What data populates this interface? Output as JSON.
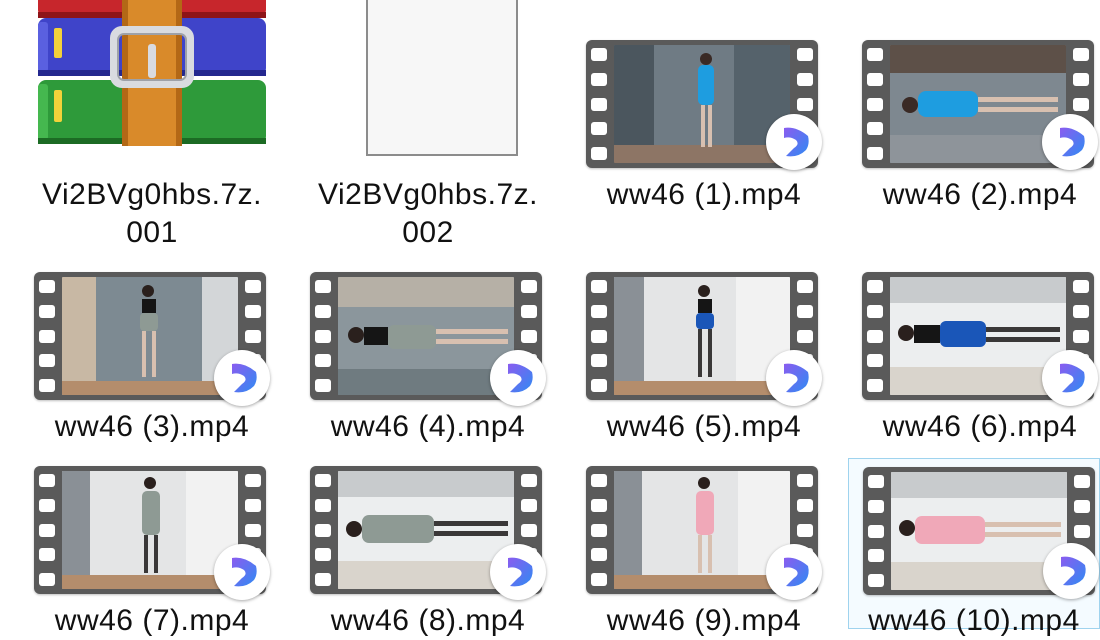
{
  "colors": {
    "film_frame": "#5a5a5a",
    "selection_border": "#9fd3ee",
    "selection_fill": "#f4fbff",
    "player_badge_blue": "#2f8bf2",
    "player_badge_purple": "#8a5cf0"
  },
  "files": [
    {
      "type": "archive-rar",
      "icon": "winrar-books-icon",
      "label_lines": [
        "Vi2BVg0hbs.7z.",
        "001"
      ]
    },
    {
      "type": "blank-file",
      "icon": "blank-document-icon",
      "label_lines": [
        "Vi2BVg0hbs.7z.",
        "002"
      ]
    },
    {
      "type": "video",
      "icon": "video-filmstrip-icon",
      "label_lines": [
        "ww46 (1).mp4"
      ]
    },
    {
      "type": "video",
      "icon": "video-filmstrip-icon",
      "label_lines": [
        "ww46 (2).mp4"
      ]
    },
    {
      "type": "video",
      "icon": "video-filmstrip-icon",
      "label_lines": [
        "ww46 (3).mp4"
      ]
    },
    {
      "type": "video",
      "icon": "video-filmstrip-icon",
      "label_lines": [
        "ww46 (4).mp4"
      ]
    },
    {
      "type": "video",
      "icon": "video-filmstrip-icon",
      "label_lines": [
        "ww46 (5).mp4"
      ]
    },
    {
      "type": "video",
      "icon": "video-filmstrip-icon",
      "label_lines": [
        "ww46 (6).mp4"
      ]
    },
    {
      "type": "video",
      "icon": "video-filmstrip-icon",
      "label_lines": [
        "ww46 (7).mp4"
      ]
    },
    {
      "type": "video",
      "icon": "video-filmstrip-icon",
      "label_lines": [
        "ww46 (8).mp4"
      ]
    },
    {
      "type": "video",
      "icon": "video-filmstrip-icon",
      "label_lines": [
        "ww46 (9).mp4"
      ]
    },
    {
      "type": "video",
      "icon": "video-filmstrip-icon",
      "label_lines": [
        "ww46 (10).mp4"
      ],
      "selected": true
    }
  ]
}
